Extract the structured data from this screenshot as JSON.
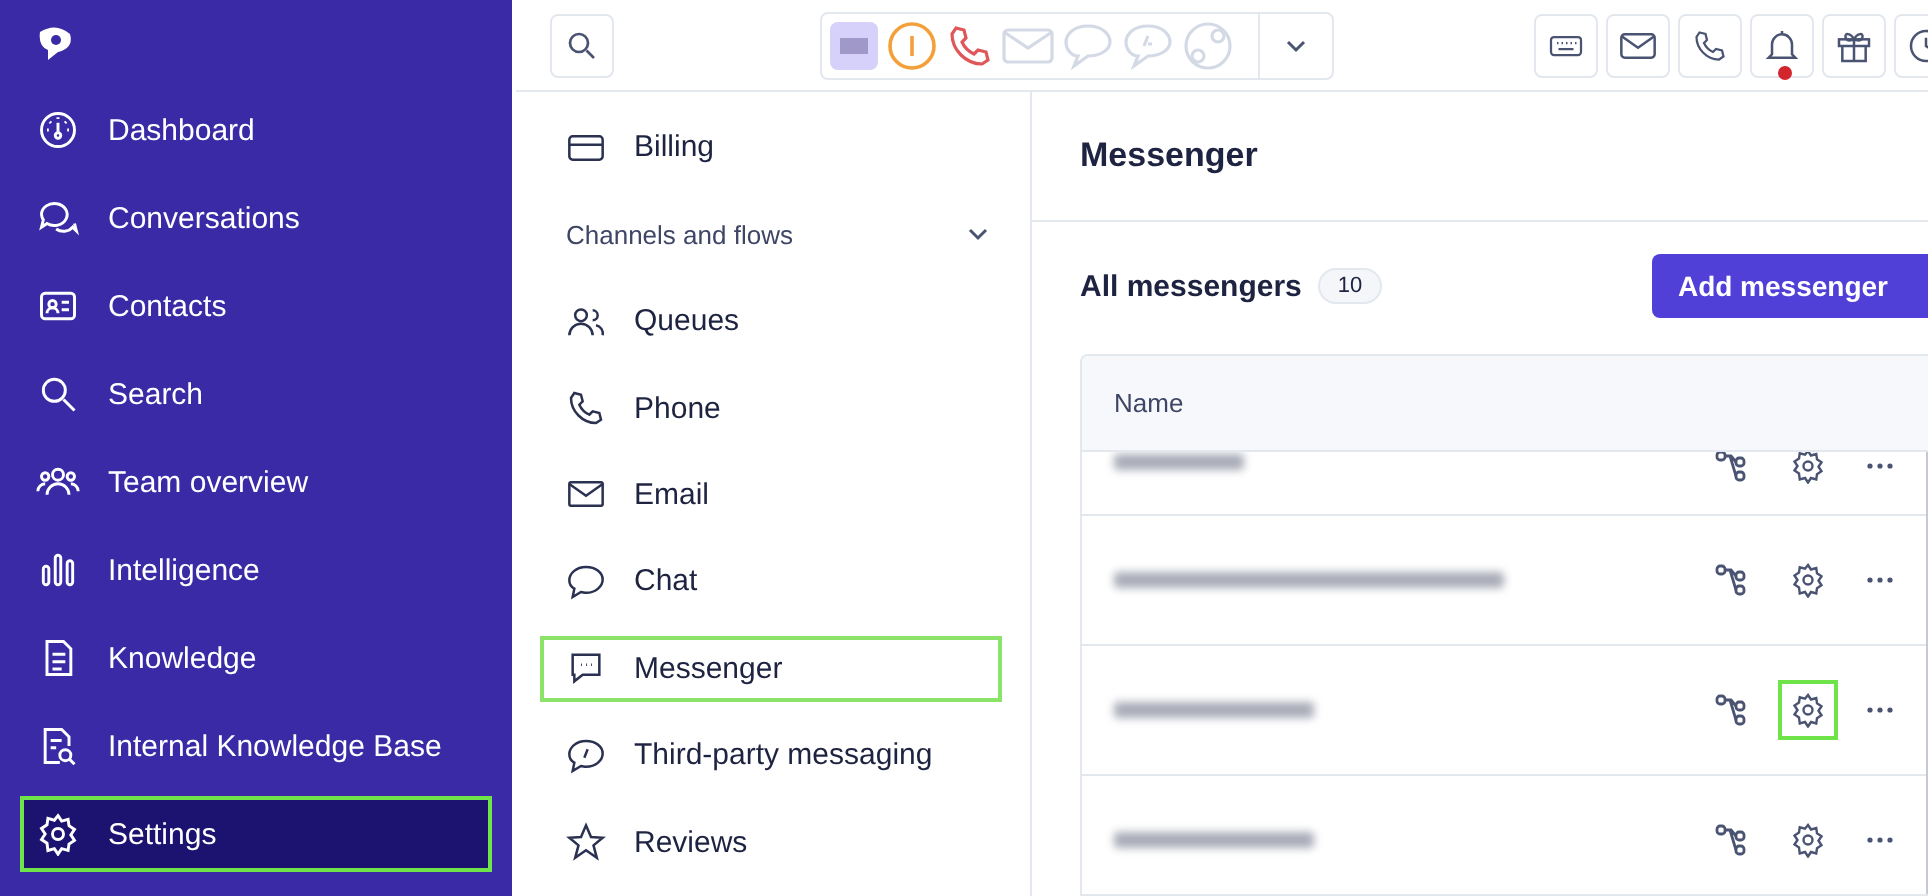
{
  "sidebar": {
    "items": [
      {
        "label": "Dashboard",
        "selected": false,
        "highlighted": false
      },
      {
        "label": "Conversations",
        "selected": false,
        "highlighted": false
      },
      {
        "label": "Contacts",
        "selected": false,
        "highlighted": false
      },
      {
        "label": "Search",
        "selected": false,
        "highlighted": false
      },
      {
        "label": "Team overview",
        "selected": false,
        "highlighted": false
      },
      {
        "label": "Intelligence",
        "selected": false,
        "highlighted": false
      },
      {
        "label": "Knowledge",
        "selected": false,
        "highlighted": false
      },
      {
        "label": "Internal Knowledge Base",
        "selected": false,
        "highlighted": false
      },
      {
        "label": "Settings",
        "selected": true,
        "highlighted": true
      }
    ]
  },
  "toolbar": {
    "notification_unread": true
  },
  "settings_menu": {
    "items": [
      {
        "kind": "item",
        "label": "Billing",
        "highlighted": false
      },
      {
        "kind": "group",
        "label": "Channels and flows",
        "expanded": true
      },
      {
        "kind": "item",
        "label": "Queues",
        "highlighted": false
      },
      {
        "kind": "item",
        "label": "Phone",
        "highlighted": false
      },
      {
        "kind": "item",
        "label": "Email",
        "highlighted": false
      },
      {
        "kind": "item",
        "label": "Chat",
        "highlighted": false
      },
      {
        "kind": "item",
        "label": "Messenger",
        "highlighted": true
      },
      {
        "kind": "item",
        "label": "Third-party messaging",
        "highlighted": false
      },
      {
        "kind": "item",
        "label": "Reviews",
        "highlighted": false
      }
    ]
  },
  "content": {
    "title": "Messenger",
    "section_title": "All messengers",
    "count": "10",
    "add_button": "Add messenger",
    "table": {
      "columns": [
        "Name"
      ],
      "rows": [
        {
          "settings_highlighted": false
        },
        {
          "settings_highlighted": false
        },
        {
          "settings_highlighted": true
        },
        {
          "settings_highlighted": false
        }
      ]
    }
  }
}
